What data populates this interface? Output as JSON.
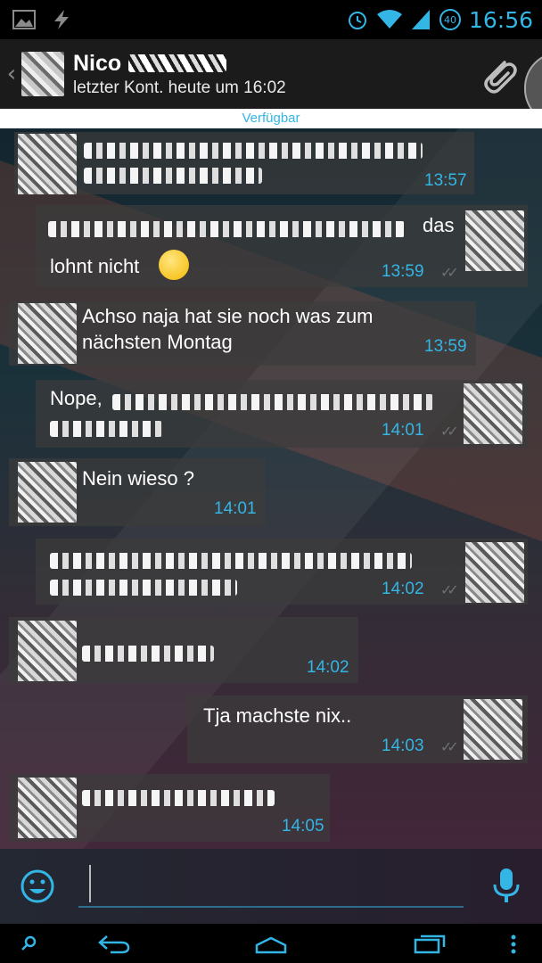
{
  "status_bar": {
    "time": "16:56",
    "battery_level": "40",
    "icons": [
      "gallery-icon",
      "flash-icon",
      "alarm-icon",
      "wifi-icon",
      "signal-icon",
      "battery-icon"
    ]
  },
  "header": {
    "contact_name": "Nico",
    "last_seen": "letzter Kont. heute um 16:02",
    "availability": "Verfügbar"
  },
  "messages": [
    {
      "direction": "incoming",
      "text": "",
      "time": "13:57"
    },
    {
      "direction": "outgoing",
      "text_tail": "das",
      "text_line2": "lohnt nicht",
      "time": "13:59",
      "emoji": "wink"
    },
    {
      "direction": "incoming",
      "text": "Achso naja hat sie noch was zum nächsten Montag",
      "line1": "Achso naja hat sie noch was zum",
      "line2": "nächsten Montag",
      "time": "13:59"
    },
    {
      "direction": "outgoing",
      "text": "Nope,",
      "time": "14:01"
    },
    {
      "direction": "incoming",
      "text": "Nein wieso ?",
      "time": "14:01"
    },
    {
      "direction": "outgoing",
      "text": "",
      "time": "14:02"
    },
    {
      "direction": "incoming",
      "text": "",
      "time": "14:02"
    },
    {
      "direction": "outgoing",
      "text": "Tja machste nix..",
      "time": "14:03"
    },
    {
      "direction": "incoming",
      "text": "",
      "time": "14:05"
    }
  ],
  "colors": {
    "accent": "#33b5e5",
    "bubble": "#3c3c3c",
    "actionbar": "#1b1b1b"
  }
}
